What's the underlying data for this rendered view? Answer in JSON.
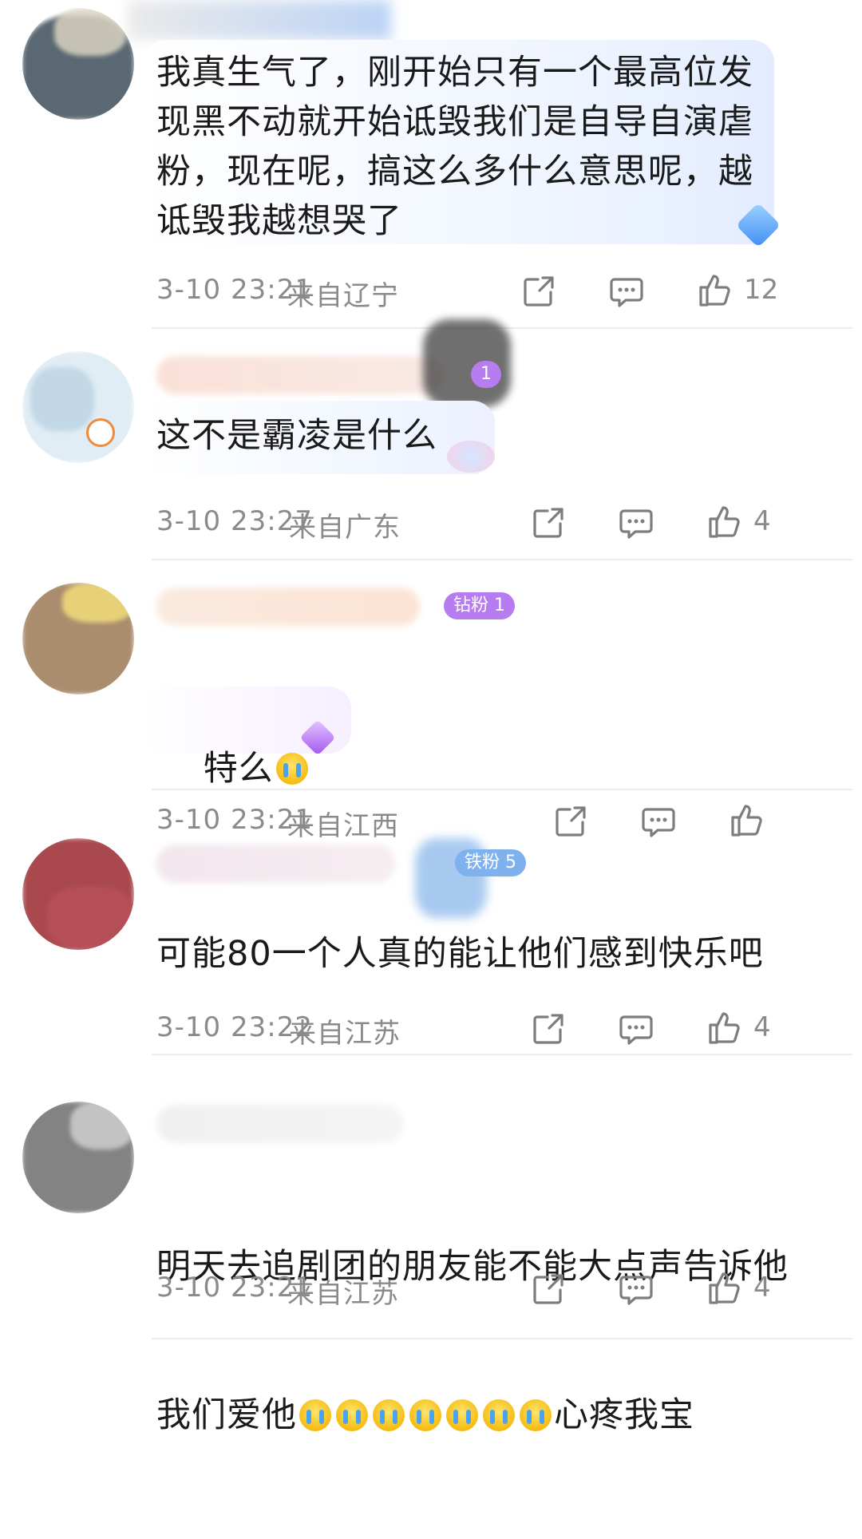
{
  "comments": [
    {
      "text": "我真生气了，刚开始只有一个最高位发\n现黑不动就开始诋毁我们是自导自演虐\n粉，现在呢，搞这么多什么意思呢，越\n诋毁我越想哭了",
      "time": "3-10 23:21",
      "location": "来自辽宁",
      "likes": "12"
    },
    {
      "badge": "1",
      "text": "这不是霸凌是什么",
      "time": "3-10 23:27",
      "location": "来自广东",
      "likes": "4"
    },
    {
      "badge": "钻粉 1",
      "text": "特么",
      "time": "3-10 23:21",
      "location": "来自江西",
      "likes": ""
    },
    {
      "badge": "铁粉 5",
      "text": "可能80一个人真的能让他们感到快乐吧",
      "time": "3-10 23:22",
      "location": "来自江苏",
      "likes": "4"
    },
    {
      "text_line1": "明天去追剧团的朋友能不能大点声告诉他",
      "text_line2_start": "我们爱他",
      "text_line2_end": "心疼我宝",
      "time": "3-10 23:21",
      "location": "来自江苏",
      "likes": "4"
    }
  ],
  "icons": {
    "share": "share-icon",
    "comment": "comment-icon",
    "like": "thumbs-up-icon",
    "emoji": "crying-face-emoji"
  },
  "colors": {
    "meta_text": "#8a8a8a",
    "badge_purple": "#b67cf0",
    "bubble_blue": "#e3ecff"
  }
}
